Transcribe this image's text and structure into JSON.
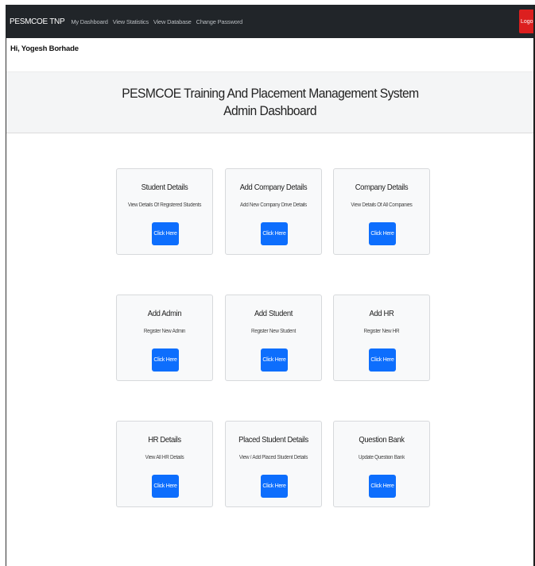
{
  "navbar": {
    "brand": "PESMCOE TNP",
    "links": [
      "My Dashboard",
      "View Statistics",
      "View Database",
      "Change Password"
    ],
    "logout_label": "Logout"
  },
  "greeting": "Hi, Yogesh Borhade",
  "header": {
    "title": "PESMCOE Training And Placement Management System",
    "subtitle": "Admin Dashboard"
  },
  "cards": [
    {
      "title": "Student Details",
      "text": "View Details Of Registered Students",
      "button": "Click Here"
    },
    {
      "title": "Add Company Details",
      "text": "Add New Company Drive Details",
      "button": "Click Here"
    },
    {
      "title": "Company Details",
      "text": "View Details Of All Companies",
      "button": "Click Here"
    },
    {
      "title": "Add Admin",
      "text": "Register New Admin",
      "button": "Click Here"
    },
    {
      "title": "Add Student",
      "text": "Register New Student",
      "button": "Click Here"
    },
    {
      "title": "Add HR",
      "text": "Register New HR",
      "button": "Click Here"
    },
    {
      "title": "HR Details",
      "text": "View All HR Details",
      "button": "Click Here"
    },
    {
      "title": "Placed Student Details",
      "text": "View / Add Placed Student Details",
      "button": "Click Here"
    },
    {
      "title": "Question Bank",
      "text": "Update Question Bank",
      "button": "Click Here"
    }
  ],
  "colors": {
    "navbar": "#212529",
    "logout": "#dc1f1f",
    "button": "#0d6efd",
    "card_bg": "#f8f9fa"
  }
}
